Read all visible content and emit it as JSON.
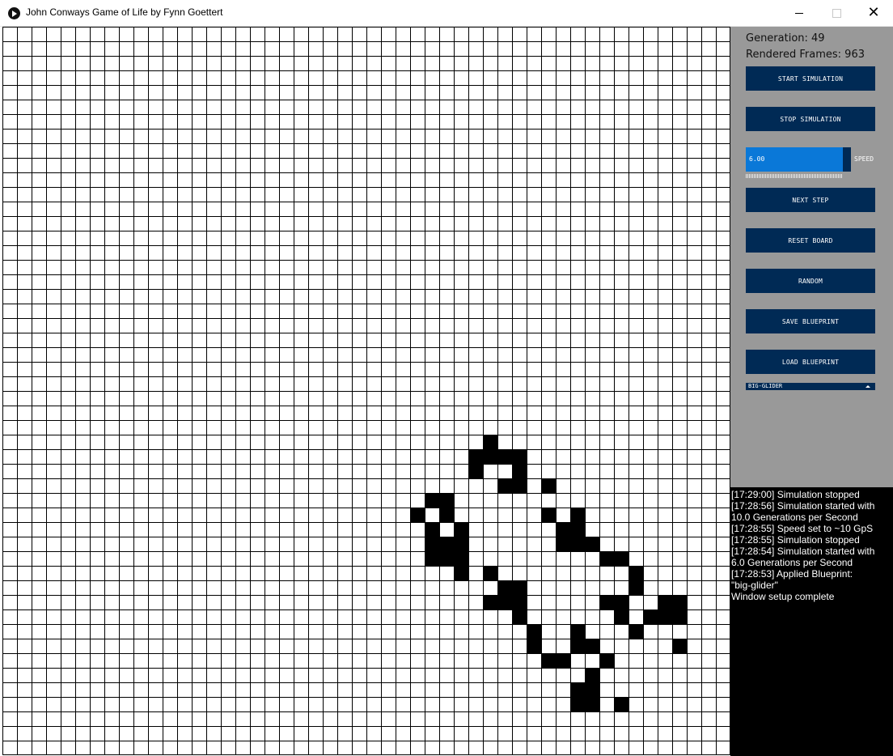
{
  "window": {
    "title": "John Conways Game of Life by Fynn Goettert",
    "icon": "play-icon"
  },
  "board": {
    "cols": 50,
    "rows": 50,
    "live_cells": [
      [
        33,
        28
      ],
      [
        32,
        29
      ],
      [
        33,
        29
      ],
      [
        34,
        29
      ],
      [
        35,
        29
      ],
      [
        32,
        30
      ],
      [
        35,
        30
      ],
      [
        34,
        31
      ],
      [
        35,
        31
      ],
      [
        37,
        31
      ],
      [
        29,
        32
      ],
      [
        30,
        32
      ],
      [
        28,
        33
      ],
      [
        30,
        33
      ],
      [
        37,
        33
      ],
      [
        39,
        33
      ],
      [
        29,
        34
      ],
      [
        31,
        34
      ],
      [
        38,
        34
      ],
      [
        39,
        34
      ],
      [
        29,
        35
      ],
      [
        30,
        35
      ],
      [
        31,
        35
      ],
      [
        38,
        35
      ],
      [
        39,
        35
      ],
      [
        40,
        35
      ],
      [
        29,
        36
      ],
      [
        30,
        36
      ],
      [
        31,
        36
      ],
      [
        41,
        36
      ],
      [
        42,
        36
      ],
      [
        31,
        37
      ],
      [
        33,
        37
      ],
      [
        43,
        37
      ],
      [
        34,
        38
      ],
      [
        35,
        38
      ],
      [
        43,
        38
      ],
      [
        33,
        39
      ],
      [
        34,
        39
      ],
      [
        35,
        39
      ],
      [
        41,
        39
      ],
      [
        42,
        39
      ],
      [
        45,
        39
      ],
      [
        46,
        39
      ],
      [
        35,
        40
      ],
      [
        42,
        40
      ],
      [
        44,
        40
      ],
      [
        45,
        40
      ],
      [
        46,
        40
      ],
      [
        36,
        41
      ],
      [
        39,
        41
      ],
      [
        43,
        41
      ],
      [
        36,
        42
      ],
      [
        39,
        42
      ],
      [
        40,
        42
      ],
      [
        46,
        42
      ],
      [
        37,
        43
      ],
      [
        38,
        43
      ],
      [
        41,
        43
      ],
      [
        40,
        44
      ],
      [
        39,
        45
      ],
      [
        40,
        45
      ],
      [
        39,
        46
      ],
      [
        40,
        46
      ],
      [
        42,
        46
      ]
    ]
  },
  "sidebar": {
    "generation": "Generation: 49",
    "rendered_frames": "Rendered Frames: 963",
    "buttons": {
      "start": "START SIMULATION",
      "stop": "STOP SIMULATION",
      "next": "NEXT STEP",
      "reset": "RESET BOARD",
      "random": "RANDOM",
      "save": "SAVE BLUEPRINT",
      "load": "LOAD BLUEPRINT"
    },
    "speed": {
      "value": "6.00",
      "label": "SPEED",
      "fraction": 0.92
    },
    "blueprint_select": "BIG-GLIDER"
  },
  "console": {
    "lines": [
      "[17:29:00] Simulation stopped",
      "[17:28:56] Simulation started with\n10.0 Generations per Second",
      "[17:28:55] Speed set to ~10 GpS",
      "[17:28:55] Simulation stopped",
      "[17:28:54] Simulation started with\n6.0 Generations per Second",
      "[17:28:53] Applied Blueprint:\n\"big-glider\"",
      "Window setup complete"
    ]
  },
  "colors": {
    "sidebar_bg": "#999999",
    "button_bg": "#002a55",
    "slider_fill": "#0a78d8",
    "console_bg": "#000000"
  }
}
